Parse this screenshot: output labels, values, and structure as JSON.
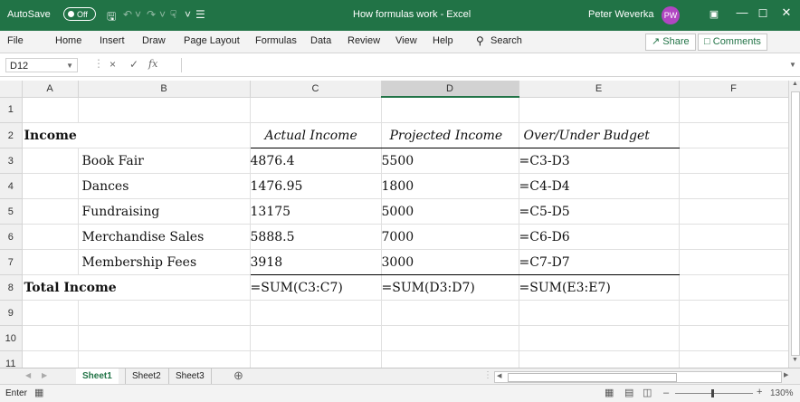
{
  "titlebar": {
    "autosave_label": "AutoSave",
    "autosave_state": "Off",
    "doc_title": "How formulas work  -  Excel",
    "user_name": "Peter Weverka",
    "user_initials": "PW"
  },
  "ribbon": {
    "tabs": [
      "File",
      "Home",
      "Insert",
      "Draw",
      "Page Layout",
      "Formulas",
      "Data",
      "Review",
      "View",
      "Help"
    ],
    "search_label": "Search",
    "share_label": "Share",
    "comments_label": "Comments"
  },
  "formula_bar": {
    "name_box": "D12",
    "function_symbol": "fx",
    "cancel_symbol": "×",
    "enter_symbol": "✓",
    "content": ""
  },
  "columns": [
    "A",
    "B",
    "C",
    "D",
    "E",
    "F"
  ],
  "rows": [
    "1",
    "2",
    "3",
    "4",
    "5",
    "6",
    "7",
    "8",
    "9",
    "10",
    "11"
  ],
  "cells": {
    "B2": "Income",
    "C2": "Actual Income",
    "D2": "Projected Income",
    "E2": "Over/Under Budget",
    "B3": "Book Fair",
    "C3": "4876.4",
    "D3": "5500",
    "E3": "=C3-D3",
    "B4": "Dances",
    "C4": "1476.95",
    "D4": "1800",
    "E4": "=C4-D4",
    "B5": "Fundraising",
    "C5": "13175",
    "D5": "5000",
    "E5": "=C5-D5",
    "B6": "Merchandise Sales",
    "C6": "5888.5",
    "D6": "7000",
    "E6": "=C6-D6",
    "B7": "Membership Fees",
    "C7": "3918",
    "D7": "3000",
    "E7": "=C7-D7",
    "B8": "Total Income",
    "C8": "=SUM(C3:C7)",
    "D8": "=SUM(D3:D7)",
    "E8": "=SUM(E3:E7)"
  },
  "sheet_tabs": [
    "Sheet1",
    "Sheet2",
    "Sheet3"
  ],
  "status": {
    "mode": "Enter",
    "zoom": "130%"
  },
  "colors": {
    "accent": "#217346",
    "avatar": "#b146c2"
  }
}
